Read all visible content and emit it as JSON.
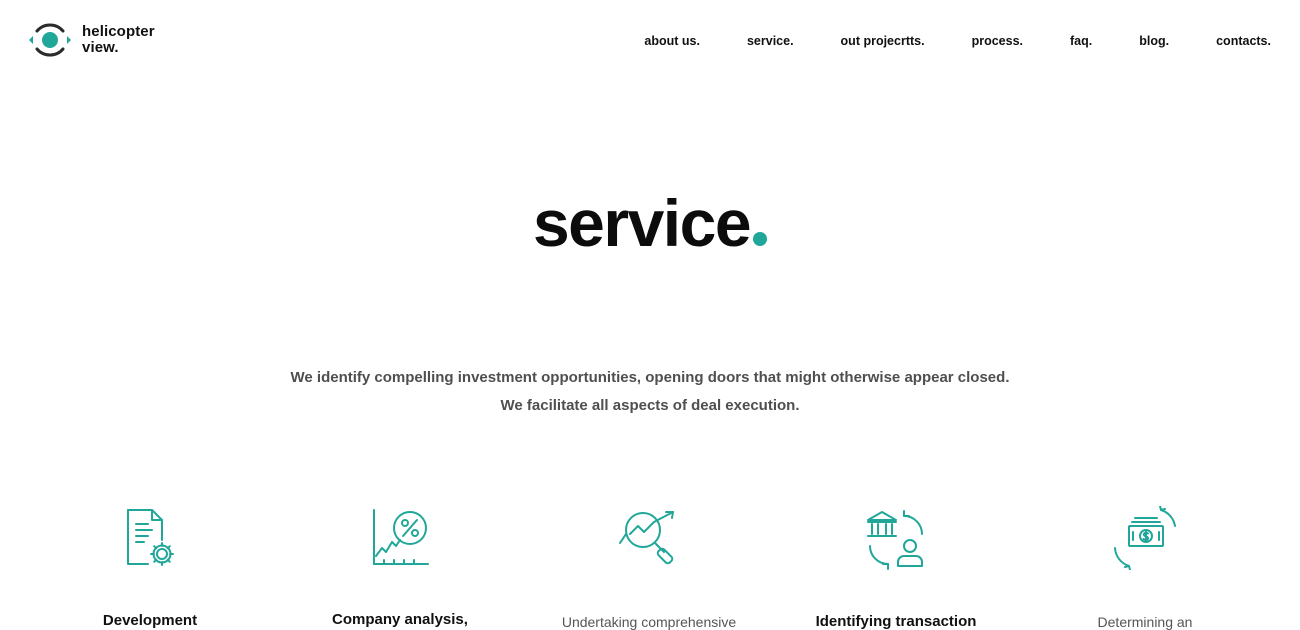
{
  "brand": {
    "line1": "helicopter",
    "line2": "view.",
    "logo_icon": "eye-icon",
    "accent": "#21a79a"
  },
  "nav": {
    "items": [
      "about us.",
      "service.",
      "out projecrtts.",
      "process.",
      "faq.",
      "blog.",
      "contacts."
    ]
  },
  "hero": {
    "title": "service",
    "subtitle_line1": "We identify compelling investment opportunities, opening doors that might otherwise appear closed.",
    "subtitle_line2": "We facilitate all aspects of deal execution."
  },
  "services": [
    {
      "icon": "document-gear-icon",
      "title": "Development"
    },
    {
      "icon": "chart-percent-icon",
      "title": "Company analysis,"
    },
    {
      "icon": "magnifier-trend-icon",
      "title": "Undertaking comprehensive"
    },
    {
      "icon": "bank-person-exchange-icon",
      "title": "Identifying transaction"
    },
    {
      "icon": "money-exchange-icon",
      "title": "Determining an"
    }
  ]
}
